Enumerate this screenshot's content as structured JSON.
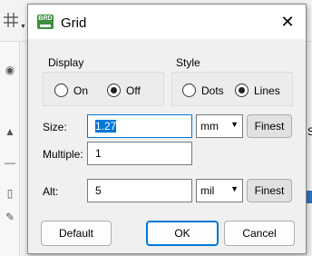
{
  "dialog": {
    "title": "Grid",
    "app_icon_text": "BRD"
  },
  "display": {
    "label": "Display",
    "options": [
      "On",
      "Off"
    ],
    "selected": "Off"
  },
  "style": {
    "label": "Style",
    "options": [
      "Dots",
      "Lines"
    ],
    "selected": "Lines"
  },
  "size": {
    "label": "Size:",
    "value": "1.27",
    "unit": "mm",
    "finest_label": "Finest"
  },
  "multiple": {
    "label": "Multiple:",
    "value": "1"
  },
  "alt": {
    "label": "Alt:",
    "value": "5",
    "unit": "mil",
    "finest_label": "Finest"
  },
  "buttons": {
    "default": "Default",
    "ok": "OK",
    "cancel": "Cancel"
  },
  "background": {
    "partial_text": "S"
  }
}
